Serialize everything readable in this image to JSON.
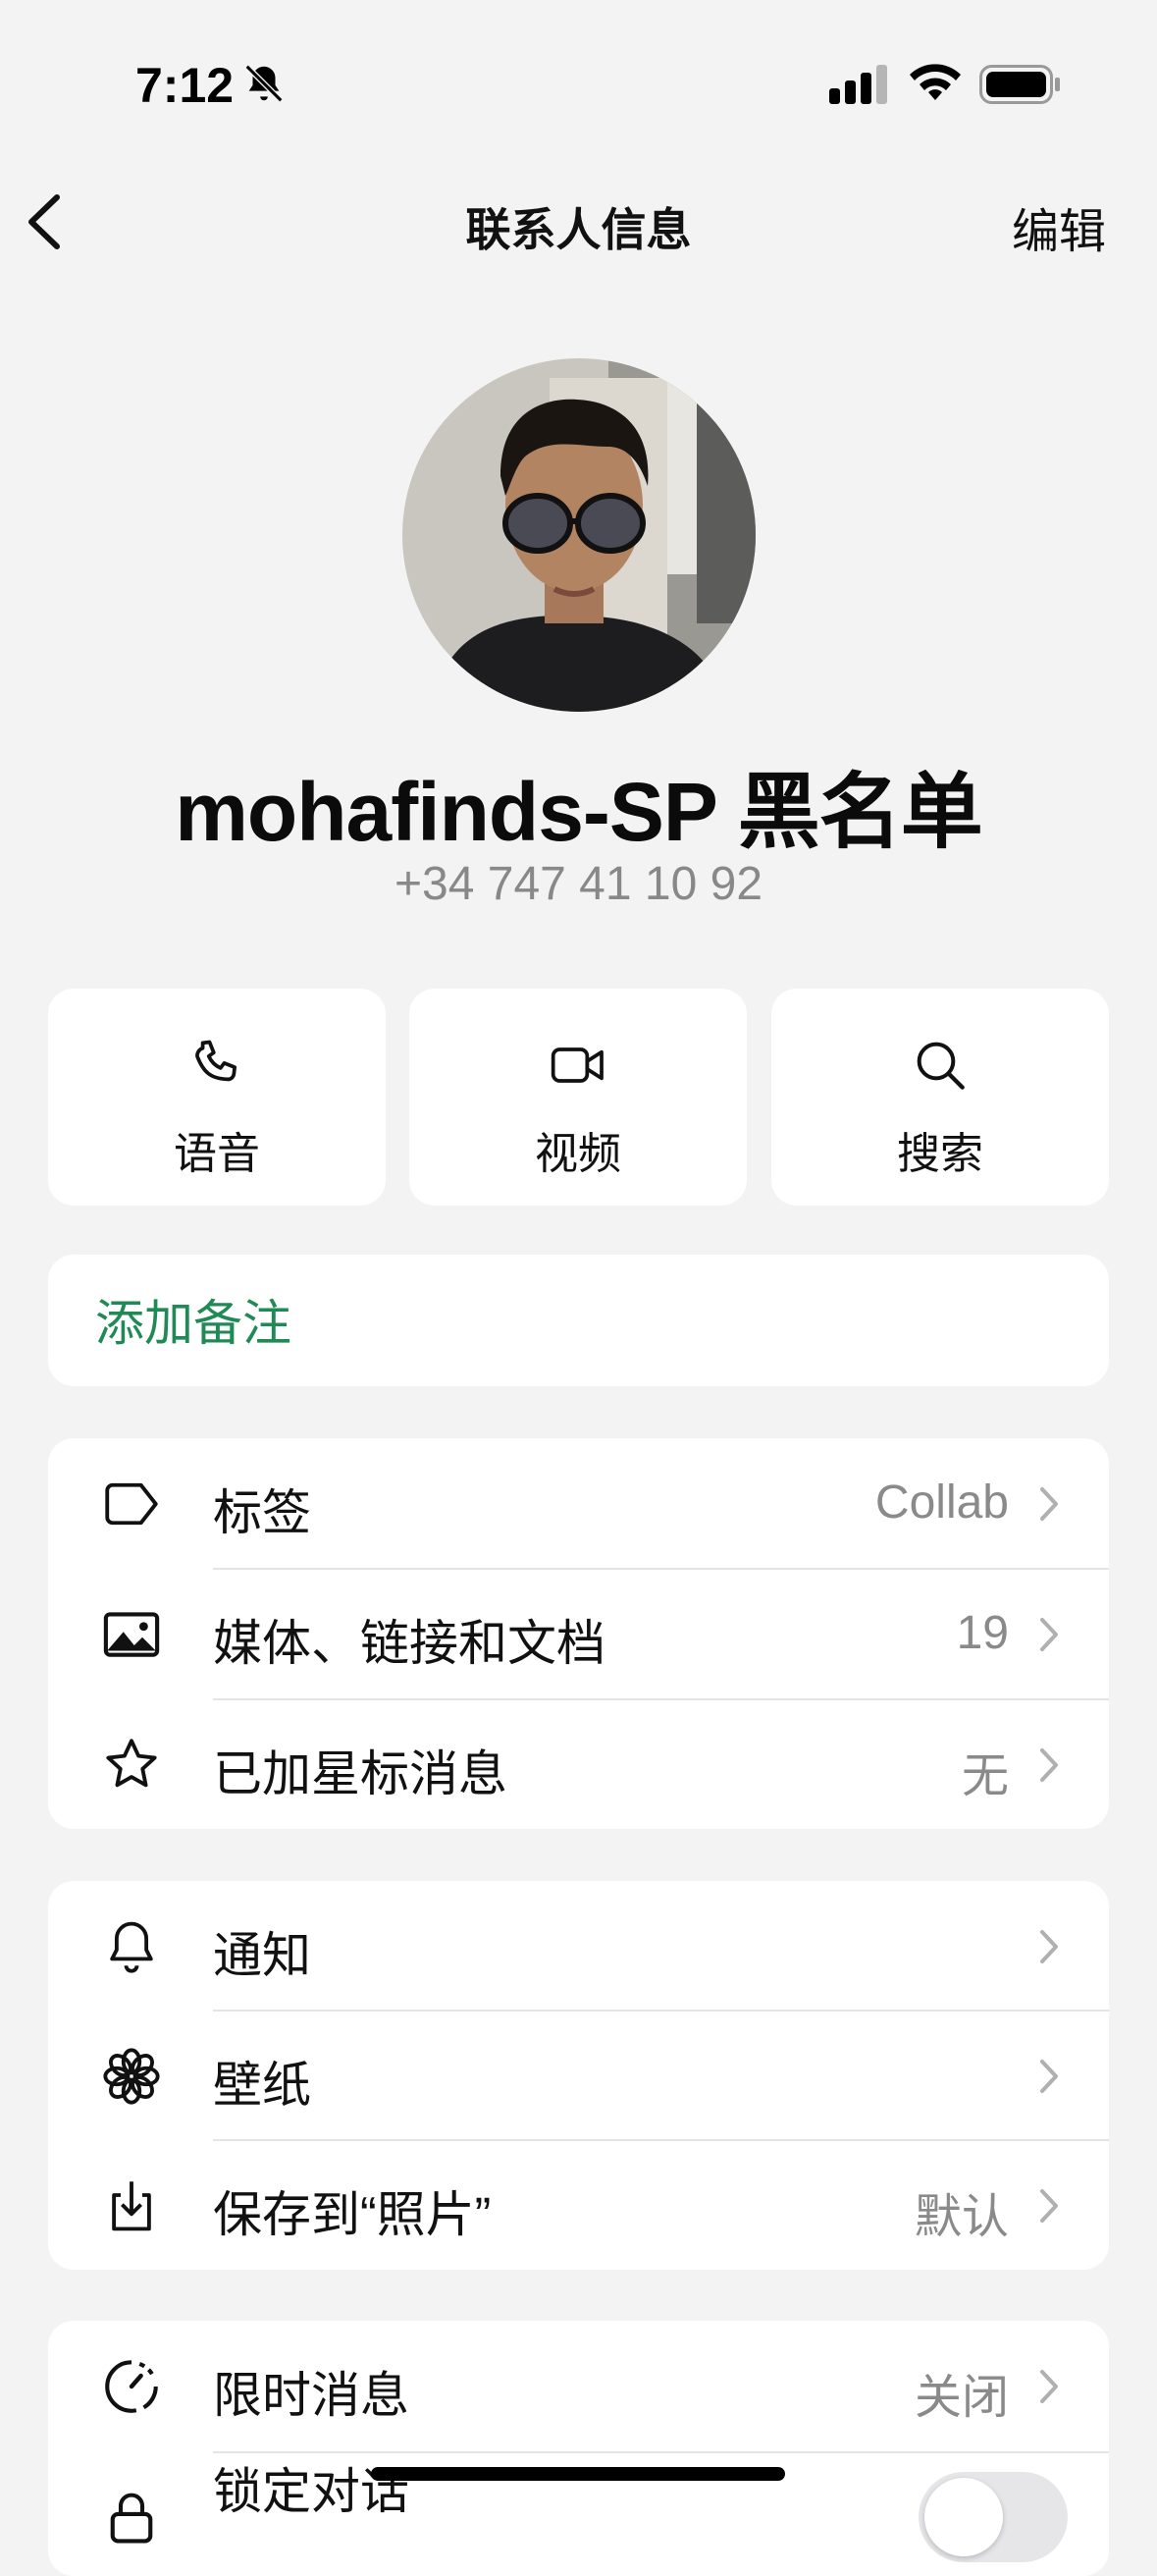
{
  "status_bar": {
    "time": "7:12",
    "icons": [
      "bell-slash-icon",
      "signal-icon",
      "wifi-icon",
      "battery-icon"
    ]
  },
  "nav": {
    "back_icon": "chevron-left-icon",
    "title": "联系人信息",
    "edit_label": "编辑"
  },
  "profile": {
    "name": "mohafinds-SP 黑名单",
    "phone": "+34 747 41 10 92"
  },
  "actions": [
    {
      "icon": "phone-icon",
      "label": "语音"
    },
    {
      "icon": "video-camera-icon",
      "label": "视频"
    },
    {
      "icon": "search-icon",
      "label": "搜索"
    }
  ],
  "note": {
    "label": "添加备注"
  },
  "section_info": [
    {
      "icon": "tag-icon",
      "label": "标签",
      "value": "Collab"
    },
    {
      "icon": "image-icon",
      "label": "媒体、链接和文档",
      "value": "19"
    },
    {
      "icon": "star-icon",
      "label": "已加星标消息",
      "value": "无"
    }
  ],
  "section_settings": [
    {
      "icon": "bell-icon",
      "label": "通知",
      "value": ""
    },
    {
      "icon": "flower-icon",
      "label": "壁纸",
      "value": ""
    },
    {
      "icon": "save-download-icon",
      "label": "保存到“照片”",
      "value": "默认"
    }
  ],
  "section_privacy": [
    {
      "icon": "timer-icon",
      "label": "限时消息",
      "value": "关闭"
    },
    {
      "icon": "lock-icon",
      "label": "锁定对话",
      "toggle": false
    }
  ],
  "colors": {
    "background": "#f3f3f3",
    "card": "#ffffff",
    "accent_green": "#1f8a55",
    "secondary_text": "#8a8a8a"
  }
}
